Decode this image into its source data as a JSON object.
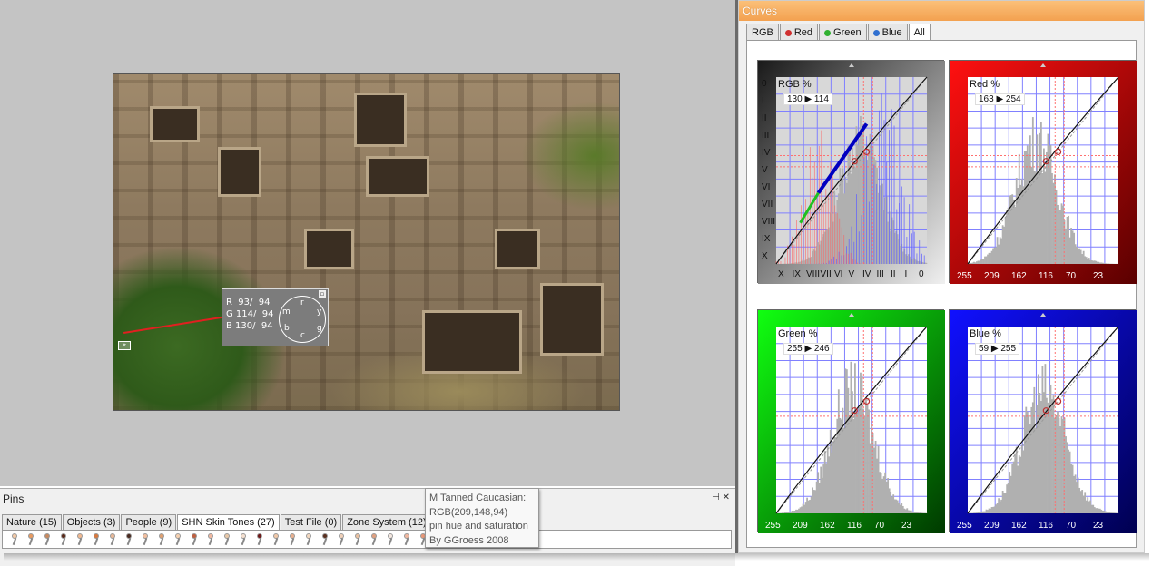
{
  "curves": {
    "title": "Curves",
    "tabs": [
      {
        "label": "RGB",
        "dot": ""
      },
      {
        "label": "Red",
        "dot": "#d03030"
      },
      {
        "label": "Green",
        "dot": "#30b030"
      },
      {
        "label": "Blue",
        "dot": "#3070d0"
      },
      {
        "label": "All",
        "dot": ""
      }
    ],
    "active_tab": "All",
    "panels": [
      {
        "id": "rgb",
        "label": "RGB %",
        "in": "130",
        "out": "114",
        "arrow": "▶",
        "bg_from": "#1a1a1a",
        "bg_to": "#f0f0f0",
        "roman_left": [
          "0",
          "I",
          "II",
          "III",
          "IV",
          "V",
          "VI",
          "VII",
          "VIII",
          "IX",
          "X"
        ],
        "roman_bottom": [
          "X",
          "IX",
          "VIII",
          "VII",
          "VI",
          "V",
          "IV",
          "III",
          "II",
          "I",
          "0"
        ]
      },
      {
        "id": "red",
        "label": "Red %",
        "in": "163",
        "out": "254",
        "arrow": "▶",
        "bg_from": "#ff1010",
        "bg_to": "#5a0000",
        "bottom": [
          "255",
          "209",
          "162",
          "116",
          "70",
          "23"
        ]
      },
      {
        "id": "green",
        "label": "Green %",
        "in": "255",
        "out": "246",
        "arrow": "▶",
        "bg_from": "#10ff10",
        "bg_to": "#003a00",
        "bottom": [
          "255",
          "209",
          "162",
          "116",
          "70",
          "23"
        ]
      },
      {
        "id": "blue",
        "label": "Blue %",
        "in": "59",
        "out": "255",
        "arrow": "▶",
        "bg_from": "#1010ff",
        "bg_to": "#000050",
        "bottom": [
          "255",
          "209",
          "162",
          "116",
          "70",
          "23"
        ]
      }
    ]
  },
  "probe": {
    "rows": [
      "R  93/  94",
      "G 114/  94",
      "B 130/  94"
    ],
    "dial_letters": [
      "r",
      "y",
      "g",
      "c",
      "b",
      "m"
    ]
  },
  "pins": {
    "title": "Pins",
    "controls": "⊣ ✕",
    "tabs": [
      {
        "label": "Nature (15)"
      },
      {
        "label": "Objects (3)"
      },
      {
        "label": "People (9)"
      },
      {
        "label": "SHN Skin Tones (27)"
      },
      {
        "label": "Test File (0)"
      },
      {
        "label": "Zone System (12)"
      }
    ],
    "active_tab": "SHN Skin Tones (27)",
    "pin_colors": [
      "#f3c9a6",
      "#e89a60",
      "#c88a60",
      "#5a2a1a",
      "#f0b890",
      "#d87a40",
      "#e8b898",
      "#4a2a20",
      "#f3c0a0",
      "#e0a070",
      "#f5d0b0",
      "#c06040",
      "#f0b8a0",
      "#e8c8a8",
      "#f5e0d0",
      "#701818",
      "#f0c8a8",
      "#e8b090",
      "#f3d8c0",
      "#5a3020",
      "#f0d0b8",
      "#e8c0a0",
      "#e0a080",
      "#f5e8e0",
      "#f0b8a0",
      "#e89878",
      "#f3c8a0",
      "#4a2818"
    ]
  },
  "tooltip": {
    "lines": [
      "M Tanned Caucasian:",
      "RGB(209,148,94)",
      "pin hue and saturation",
      "By GGroess 2008"
    ]
  }
}
